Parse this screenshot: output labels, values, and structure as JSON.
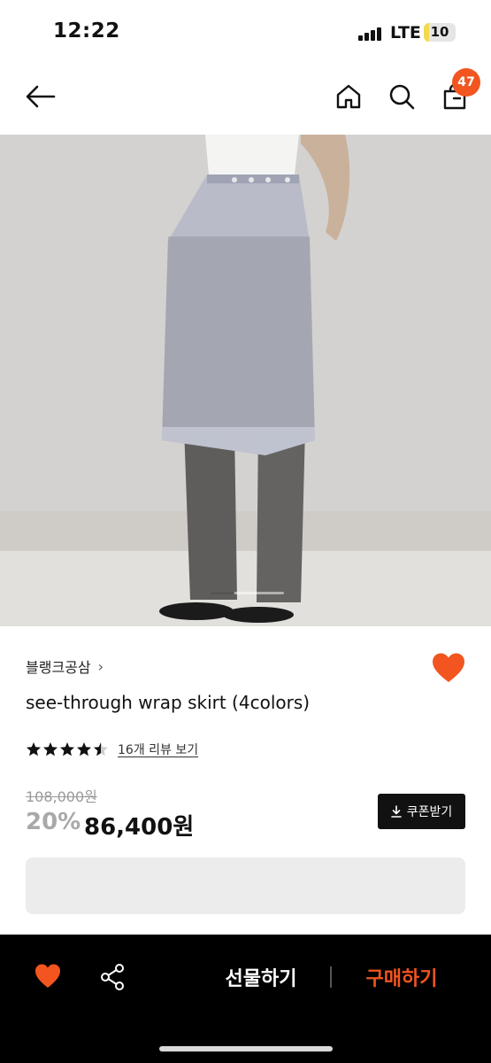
{
  "status_bar": {
    "time": "12:22",
    "network": "LTE",
    "battery": "10",
    "battery_level": 0.1
  },
  "top_nav": {
    "back_icon": "arrow-left-icon",
    "home_icon": "home-icon",
    "search_icon": "search-icon",
    "cart_icon": "shopping-bag-icon",
    "cart_count": "47"
  },
  "product": {
    "image_icon": "product-photo",
    "brand": "블랭크공삼",
    "brand_chevron": "›",
    "title": "see-through wrap skirt (4colors)",
    "rating": 4.5,
    "review_link": "16개 리뷰 보기",
    "original_price": "108,000원",
    "discount_rate": "20%",
    "sale_price": "86,400원",
    "coupon_label": "쿠폰받기",
    "coupon_icon": "download-icon"
  },
  "bottom_bar": {
    "wish_icon": "heart-icon",
    "share_icon": "share-icon",
    "gift_label": "선물하기",
    "buy_label": "구매하기"
  },
  "colors": {
    "accent": "#f2551f",
    "bottom_bar_bg": "#000000",
    "star": "#111111"
  }
}
